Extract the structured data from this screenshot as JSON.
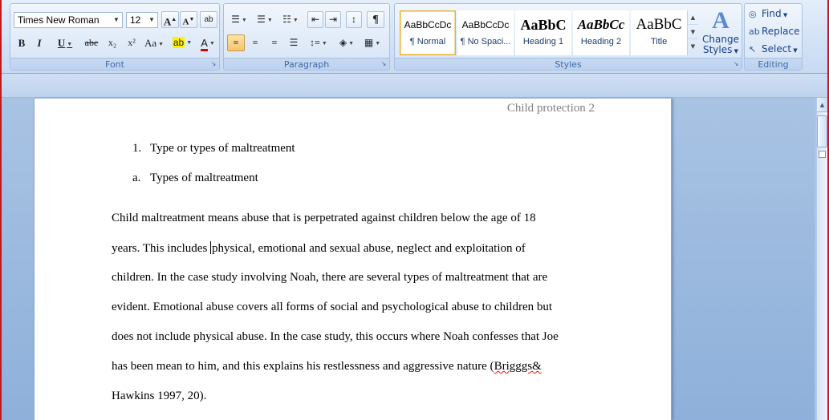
{
  "ribbon": {
    "font": {
      "group_label": "Font",
      "font_name": "Times New Roman",
      "font_size": "12",
      "bold": "B",
      "italic": "I",
      "underline": "U",
      "strike": "abe",
      "subscript": "x₂",
      "superscript": "x²",
      "change_case": "Aa",
      "grow": "A",
      "shrink": "A",
      "font_color_letter": "A",
      "highlight_letter": "ab",
      "clear_format": "ab"
    },
    "paragraph": {
      "group_label": "Paragraph"
    },
    "styles": {
      "group_label": "Styles",
      "items": [
        {
          "sample": "AaBbCcDc",
          "name": "¶ Normal"
        },
        {
          "sample": "AaBbCcDc",
          "name": "¶ No Spaci..."
        },
        {
          "sample": "AaBbC",
          "name": "Heading 1"
        },
        {
          "sample": "AaBbCc",
          "name": "Heading 2"
        },
        {
          "sample": "AaBbC",
          "name": "Title"
        }
      ],
      "change_styles_line1": "Change",
      "change_styles_line2": "Styles"
    },
    "editing": {
      "group_label": "Editing",
      "find": "Find",
      "replace": "Replace",
      "select": "Select"
    }
  },
  "document": {
    "header": "Child protection 2",
    "list": [
      {
        "marker": "1.",
        "text": "Type or types of maltreatment"
      },
      {
        "marker": "a.",
        "text": "Types of maltreatment"
      }
    ],
    "body_lines": [
      "Child maltreatment means abuse that is perpetrated against children below the age of 18",
      "This includes",
      "physical, emotional and sexual abuse, neglect and exploitation of",
      "children. In the case study involving Noah, there are several types of maltreatment that are",
      "evident. Emotional abuse covers all forms of social and psychological abuse to children but",
      "does not include physical abuse. In the case study, this occurs where Noah confesses that Joe",
      "has been mean to him, and this explains his restlessness and aggressive nature (",
      "Hawkins 1997, 20)."
    ],
    "line2_prefix": "years.",
    "misspelled": "Brigggs&"
  },
  "colors": {
    "frame_red": "#c2191f",
    "ribbon_text": "#15428b",
    "selected_style_border": "#e6b045",
    "pressed_button": "#f7c56a",
    "highlight_yellow": "#fff200",
    "font_color_red": "#e00000"
  }
}
